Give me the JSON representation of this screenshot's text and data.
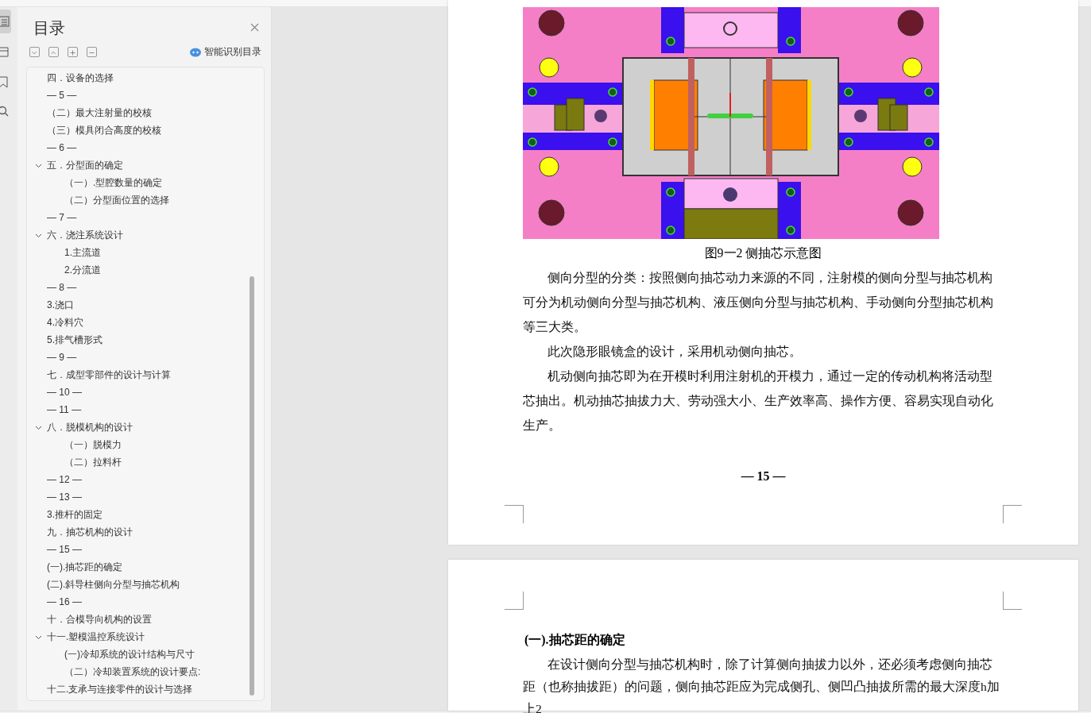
{
  "rail_tabs": [
    {
      "kind": "outline",
      "selected": true
    },
    {
      "kind": "pages",
      "selected": false
    },
    {
      "kind": "bookmark",
      "selected": false
    },
    {
      "kind": "search",
      "selected": false
    }
  ],
  "toc": {
    "title": "目录",
    "tools": [
      {
        "kind": "collapse"
      },
      {
        "kind": "expand"
      },
      {
        "kind": "plus"
      },
      {
        "kind": "minus"
      }
    ],
    "smart_button": "智能识别目录",
    "items": [
      {
        "label": "四．设备的选择"
      },
      {
        "label": "— 5 —"
      },
      {
        "label": "（二）最大注射量的校核"
      },
      {
        "label": "（三）模具闭合高度的校核"
      },
      {
        "label": "— 6 —"
      },
      {
        "label": "五．分型面的确定",
        "expanded": true,
        "children": [
          {
            "label": "（一）.型腔数量的确定"
          },
          {
            "label": "（二）分型面位置的选择"
          }
        ]
      },
      {
        "label": "— 7 —"
      },
      {
        "label": "六．浇注系统设计",
        "expanded": true,
        "children": [
          {
            "label": "1.主流道"
          },
          {
            "label": "2.分流道"
          }
        ]
      },
      {
        "label": "— 8 —"
      },
      {
        "label": "3.浇口"
      },
      {
        "label": "4.冷料穴"
      },
      {
        "label": "5.排气槽形式"
      },
      {
        "label": "— 9 —"
      },
      {
        "label": "七．成型零部件的设计与计算"
      },
      {
        "label": "— 10 —"
      },
      {
        "label": "— 11 —"
      },
      {
        "label": "八．脱模机构的设计",
        "expanded": true,
        "children": [
          {
            "label": "（一）脱模力"
          },
          {
            "label": "（二）拉料杆"
          }
        ]
      },
      {
        "label": "— 12 —"
      },
      {
        "label": "— 13 —"
      },
      {
        "label": "3.推杆的固定"
      },
      {
        "label": "九．抽芯机构的设计"
      },
      {
        "label": "— 15 —"
      },
      {
        "label": "(一).抽芯距的确定"
      },
      {
        "label": "(二).斜导柱侧向分型与抽芯机构"
      },
      {
        "label": "— 16 —"
      },
      {
        "label": "十．合模导向机构的设置"
      },
      {
        "label": "十一.塑模温控系统设计",
        "expanded": true,
        "children": [
          {
            "label": "(一)冷却系统的设计结构与尺寸"
          },
          {
            "label": "（二）冷却装置系统的设计要点:"
          }
        ]
      },
      {
        "label": "十二.支承与连接零件的设计与选择"
      }
    ]
  },
  "pages": [
    {
      "caption": "图9一2  侧抽芯示意图",
      "paragraphs": [
        "侧向分型的分类：按照侧向抽芯动力来源的不同，注射模的侧向分型与抽芯机构可分为机动侧向分型与抽芯机构、液压侧向分型与抽芯机构、手动侧向分型抽芯机构等三大类。",
        "此次隐形眼镜盒的设计，采用机动侧向抽芯。",
        "机动侧向抽芯即为在开模时利用注射机的开模力，通过一定的传动机构将活动型芯抽出。机动抽芯抽拔力大、劳动强大小、生产效率高、操作方便、容易实现自动化生产。"
      ],
      "page_number": "— 15 —"
    },
    {
      "heading": "(一).抽芯距的确定",
      "paragraphs": [
        "在设计侧向分型与抽芯机构时，除了计算侧向抽拔力以外，还必须考虑侧向抽芯距（也称抽拔距）的问题，侧向抽芯距应为完成侧孔、侧凹凸抽拔所需的最大深度h加上2"
      ]
    }
  ]
}
